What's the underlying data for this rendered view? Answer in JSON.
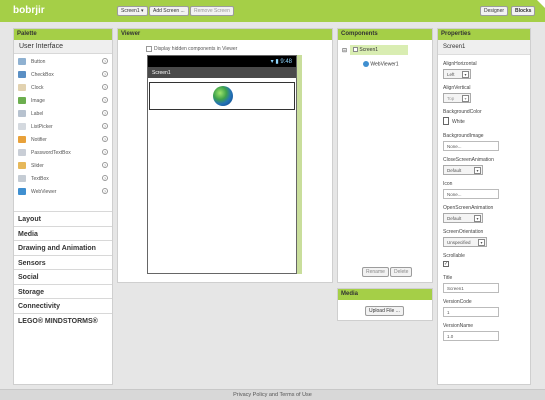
{
  "app": {
    "title": "bobrjir"
  },
  "toolbar": {
    "screen_select": "Screen1 ▾",
    "add_screen": "Add Screen ...",
    "remove_screen": "Remove Screen",
    "designer": "Designer",
    "blocks": "Blocks"
  },
  "palette": {
    "title": "Palette",
    "group_title": "User Interface",
    "items": [
      {
        "label": "Button",
        "icon": "button-icon",
        "color": "#8fb1d1"
      },
      {
        "label": "CheckBox",
        "icon": "checkbox-icon",
        "color": "#5a8fc4"
      },
      {
        "label": "Clock",
        "icon": "clock-icon",
        "color": "#e2d2b0"
      },
      {
        "label": "Image",
        "icon": "image-icon",
        "color": "#6cae4e"
      },
      {
        "label": "Label",
        "icon": "label-icon",
        "color": "#b7c2cf"
      },
      {
        "label": "ListPicker",
        "icon": "listpicker-icon",
        "color": "#d4d9df"
      },
      {
        "label": "Notifier",
        "icon": "notifier-icon",
        "color": "#e8a13a"
      },
      {
        "label": "PasswordTextBox",
        "icon": "password-icon",
        "color": "#c9ced6"
      },
      {
        "label": "Slider",
        "icon": "slider-icon",
        "color": "#e6b85a"
      },
      {
        "label": "TextBox",
        "icon": "textbox-icon",
        "color": "#c5ccd4"
      },
      {
        "label": "WebViewer",
        "icon": "webviewer-icon",
        "color": "#3f8fd0"
      }
    ],
    "help_glyph": "?",
    "categories": [
      "Layout",
      "Media",
      "Drawing and Animation",
      "Sensors",
      "Social",
      "Storage",
      "Connectivity",
      "LEGO® MINDSTORMS®"
    ]
  },
  "viewer": {
    "title": "Viewer",
    "hidden_checkbox_label": "Display hidden components in Viewer",
    "status_time": "9:48",
    "screen_title": "Screen1"
  },
  "components": {
    "title": "Components",
    "root_toggle": "⊟",
    "root": "Screen1",
    "child": "WebViewer1",
    "rename": "Rename",
    "delete": "Delete"
  },
  "media": {
    "title": "Media",
    "upload": "Upload File ..."
  },
  "properties": {
    "title": "Properties",
    "component": "Screen1",
    "align_horizontal_label": "AlignHorizontal",
    "align_horizontal_value": "Left",
    "align_vertical_label": "AlignVertical",
    "align_vertical_value": "Top",
    "bg_color_label": "BackgroundColor",
    "bg_color_value": "White",
    "bg_image_label": "BackgroundImage",
    "bg_image_value": "None...",
    "close_anim_label": "CloseScreenAnimation",
    "close_anim_value": "Default",
    "icon_label": "Icon",
    "icon_value": "None...",
    "open_anim_label": "OpenScreenAnimation",
    "open_anim_value": "Default",
    "orientation_label": "ScreenOrientation",
    "orientation_value": "Unspecified",
    "scrollable_label": "Scrollable",
    "title_label": "Title",
    "title_value": "Screen1",
    "version_code_label": "VersionCode",
    "version_code_value": "1",
    "version_name_label": "VersionName",
    "version_name_value": "1.0",
    "arrow": "▾"
  },
  "footer": {
    "text": "Privacy Policy and Terms of Use"
  },
  "colors": {
    "accent": "#a5cf47",
    "background": "#e6e6e6"
  }
}
